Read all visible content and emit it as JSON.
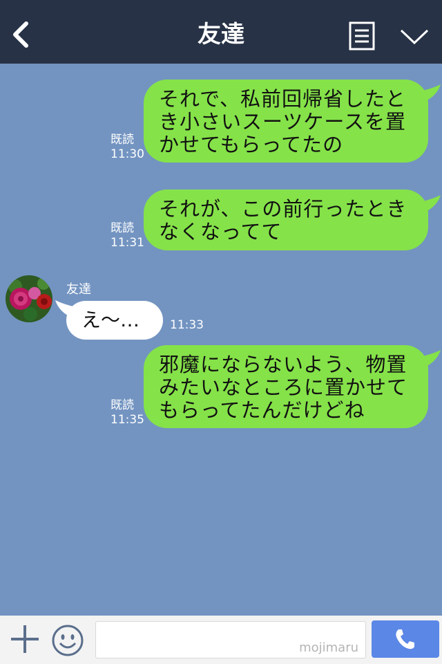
{
  "header": {
    "title": "友達"
  },
  "messages": [
    {
      "text": "それで、私前回帰省したと\nき小さいスーツケースを置\nかせてもらってたの",
      "read": "既読",
      "time": "11:30"
    },
    {
      "text": "それが、この前行ったとき\nなくなってて",
      "read": "既読",
      "time": "11:31"
    },
    {
      "text": "邪魔にならないよう、物置\nみたいなところに置かせて\nもらってたんだけどね",
      "read": "既読",
      "time": "11:35"
    }
  ],
  "incoming": {
    "sender": "友達",
    "text": "え〜…",
    "time": "11:33"
  },
  "footer": {
    "watermark": "mojimaru"
  },
  "colors": {
    "header": "#273246",
    "chat_bg": "#7394c1",
    "bubble_out": "#85e249",
    "call_button": "#5b87e6"
  }
}
